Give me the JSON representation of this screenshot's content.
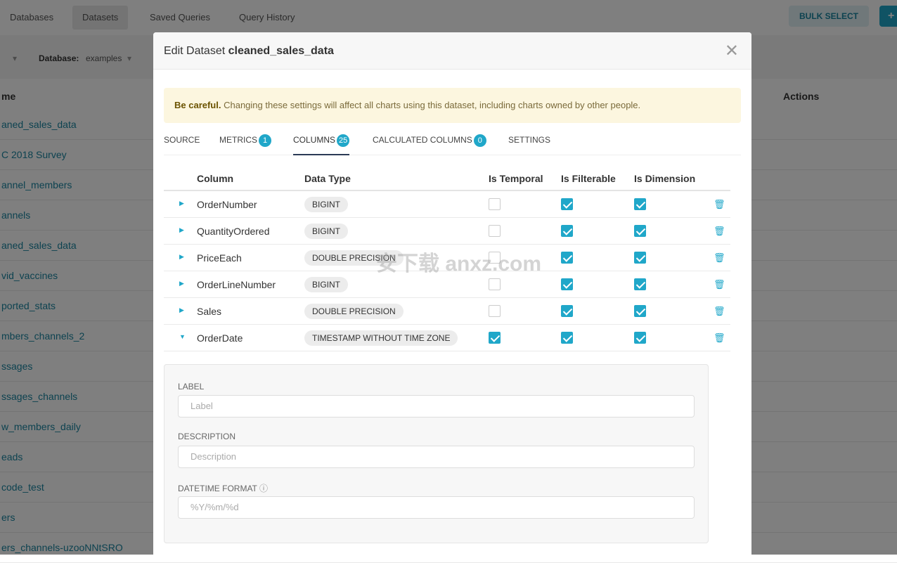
{
  "nav": {
    "items": [
      "Databases",
      "Datasets",
      "Saved Queries",
      "Query History"
    ],
    "active": "Datasets",
    "bulk_select": "BULK SELECT",
    "add": "+"
  },
  "filters": {
    "database_label": "Database:",
    "database_value": "examples"
  },
  "list": {
    "name_header": "me",
    "actions_header": "Actions",
    "rows": [
      "aned_sales_data",
      "C 2018 Survey",
      "annel_members",
      "annels",
      "aned_sales_data",
      "vid_vaccines",
      "ported_stats",
      "mbers_channels_2",
      "ssages",
      "ssages_channels",
      "w_members_daily",
      "eads",
      "code_test",
      "ers",
      "ers_channels-uzooNNtSRO"
    ]
  },
  "modal": {
    "title_prefix": "Edit Dataset",
    "title_name": "cleaned_sales_data",
    "alert_bold": "Be careful.",
    "alert_text": " Changing these settings will affect all charts using this dataset, including charts owned by other people.",
    "tabs": [
      {
        "label": "SOURCE"
      },
      {
        "label": "METRICS",
        "badge": "1"
      },
      {
        "label": "COLUMNS",
        "badge": "25",
        "active": true
      },
      {
        "label": "CALCULATED COLUMNS",
        "badge": "0"
      },
      {
        "label": "SETTINGS"
      }
    ],
    "table": {
      "headers": [
        "Column",
        "Data Type",
        "Is Temporal",
        "Is Filterable",
        "Is Dimension"
      ],
      "rows": [
        {
          "name": "OrderNumber",
          "type": "BIGINT",
          "temporal": false,
          "filterable": true,
          "dimension": true,
          "expanded": false
        },
        {
          "name": "QuantityOrdered",
          "type": "BIGINT",
          "temporal": false,
          "filterable": true,
          "dimension": true,
          "expanded": false
        },
        {
          "name": "PriceEach",
          "type": "DOUBLE PRECISION",
          "temporal": false,
          "filterable": true,
          "dimension": true,
          "expanded": false
        },
        {
          "name": "OrderLineNumber",
          "type": "BIGINT",
          "temporal": false,
          "filterable": true,
          "dimension": true,
          "expanded": false
        },
        {
          "name": "Sales",
          "type": "DOUBLE PRECISION",
          "temporal": false,
          "filterable": true,
          "dimension": true,
          "expanded": false
        },
        {
          "name": "OrderDate",
          "type": "TIMESTAMP WITHOUT TIME ZONE",
          "temporal": true,
          "filterable": true,
          "dimension": true,
          "expanded": true
        }
      ]
    },
    "detail": {
      "label_label": "LABEL",
      "label_placeholder": "Label",
      "description_label": "DESCRIPTION",
      "description_placeholder": "Description",
      "datetime_label": "DATETIME FORMAT",
      "datetime_placeholder": "%Y/%m/%d"
    }
  },
  "watermark": "安下载 anxz.com",
  "colors": {
    "accent": "#20a7c9",
    "alert_bg": "#fcf6df"
  }
}
